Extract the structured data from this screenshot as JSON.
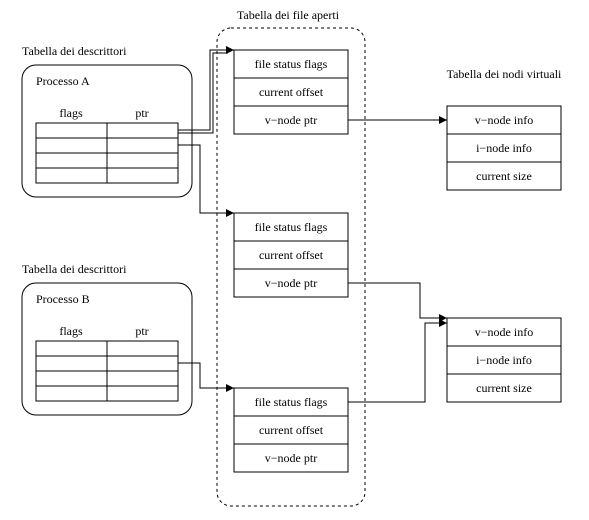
{
  "titles": {
    "open_files": "Tabella dei file aperti",
    "descriptors": "Tabella dei descrittori",
    "vnodes": "Tabella dei nodi virtuali"
  },
  "process_a": {
    "label": "Processo A",
    "columns": {
      "flags": "flags",
      "ptr": "ptr"
    }
  },
  "process_b": {
    "label": "Processo B",
    "columns": {
      "flags": "flags",
      "ptr": "ptr"
    }
  },
  "file_entry": {
    "status_flags": "file status flags",
    "offset": "current offset",
    "vnode_ptr": "v−node ptr"
  },
  "vnode_entry": {
    "info": "v−node info",
    "inode": "i−node info",
    "size": "current size"
  }
}
